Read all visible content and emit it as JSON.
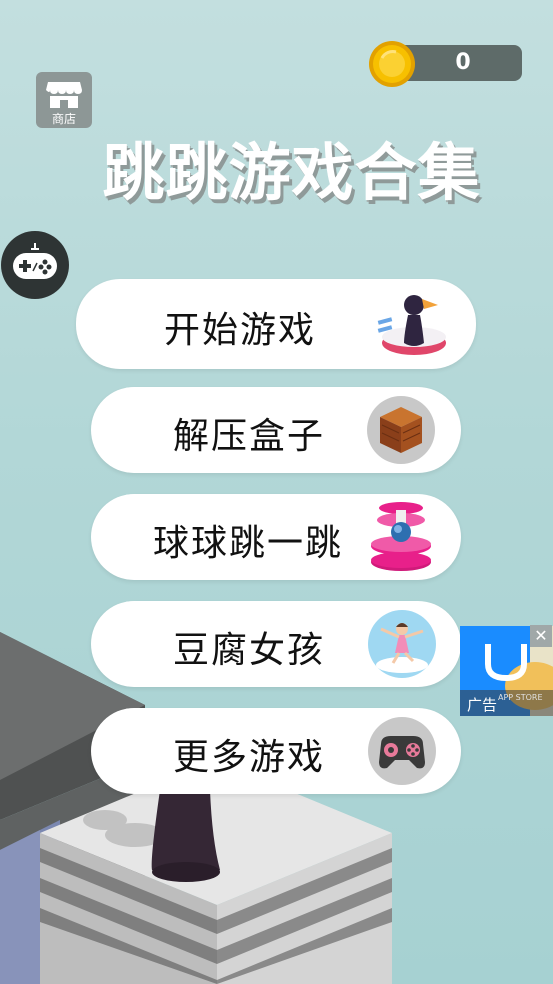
{
  "coins": {
    "count": "0"
  },
  "shop": {
    "label": "商店"
  },
  "title": "跳跳游戏合集",
  "menu": {
    "items": [
      {
        "label": "开始游戏",
        "icon": "jump-character-icon"
      },
      {
        "label": "解压盒子",
        "icon": "wood-cube-icon"
      },
      {
        "label": "球球跳一跳",
        "icon": "helix-ball-icon"
      },
      {
        "label": "豆腐女孩",
        "icon": "tofu-girl-icon"
      },
      {
        "label": "更多游戏",
        "icon": "gamepad-icon"
      }
    ]
  },
  "ad": {
    "label": "广告",
    "close": "✕",
    "store_text": "APP STORE"
  },
  "colors": {
    "background": "#b2d7d7",
    "coin": "#f5b800",
    "ad_blue": "#1a8cff",
    "pink": "#e8208a"
  }
}
